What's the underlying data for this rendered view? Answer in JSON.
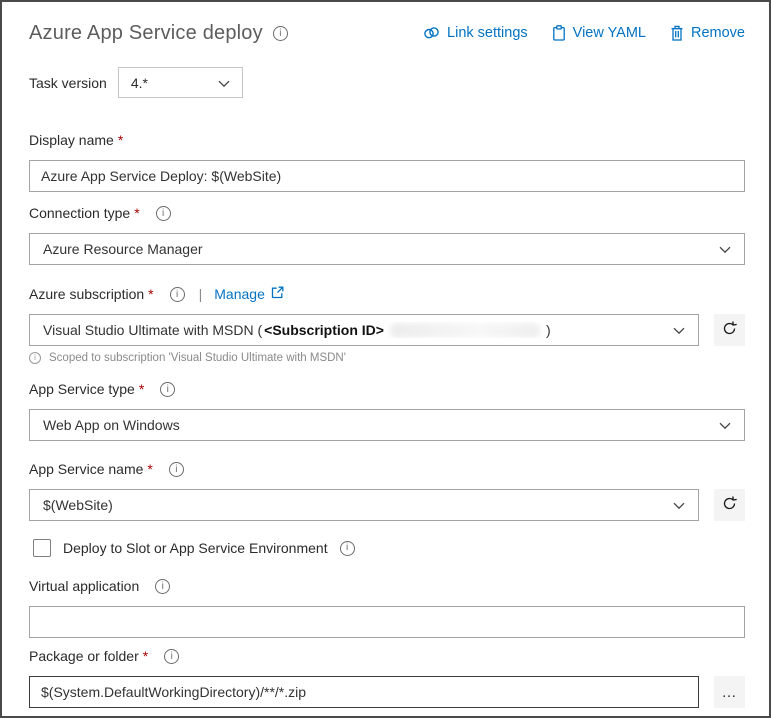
{
  "ui": {
    "required_mark": "*",
    "ellipsis": "…",
    "pipe": "|"
  },
  "header": {
    "title": "Azure App Service deploy",
    "actions": {
      "link_settings": "Link settings",
      "view_yaml": "View YAML",
      "remove": "Remove"
    }
  },
  "task_version": {
    "label": "Task version",
    "value": "4.*"
  },
  "fields": {
    "display_name": {
      "label": "Display name",
      "value": "Azure App Service Deploy: $(WebSite)"
    },
    "connection_type": {
      "label": "Connection type",
      "value": "Azure Resource Manager"
    },
    "azure_subscription": {
      "label": "Azure subscription",
      "manage_label": "Manage",
      "value_prefix": "Visual Studio Ultimate with MSDN (",
      "redacted_placeholder": "<Subscription ID>",
      "value_suffix": ")",
      "hint": "Scoped to subscription 'Visual Studio Ultimate with MSDN'"
    },
    "app_service_type": {
      "label": "App Service type",
      "value": "Web App on Windows"
    },
    "app_service_name": {
      "label": "App Service name",
      "value": "$(WebSite)"
    },
    "deploy_to_slot": {
      "label": "Deploy to Slot or App Service Environment",
      "checked": false
    },
    "virtual_application": {
      "label": "Virtual application",
      "value": ""
    },
    "package_or_folder": {
      "label": "Package or folder",
      "value": "$(System.DefaultWorkingDirectory)/**/*.zip"
    }
  },
  "colors": {
    "accent": "#0273c3",
    "required": "#a80000"
  }
}
